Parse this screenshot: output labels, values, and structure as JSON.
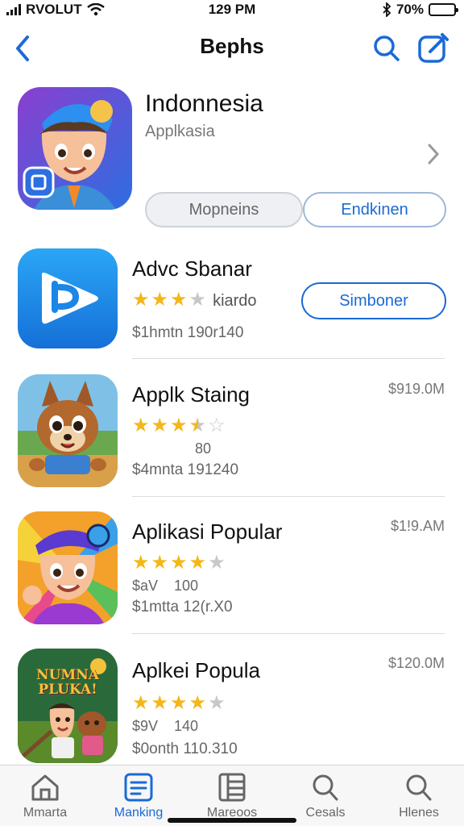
{
  "status_bar": {
    "carrier": "RVOLUT",
    "time": "129 PM",
    "battery": "70%",
    "battery_level": 0.7
  },
  "nav": {
    "title": "Bephs"
  },
  "featured": {
    "title": "Indonnesia",
    "subtitle": "Applkasia",
    "segments": [
      "Mopneins",
      "Endkinen"
    ]
  },
  "apps": [
    {
      "title": "Advc Sbanar",
      "rating": 3,
      "rating_text": "kiardo",
      "meta": "$1hmtn 190r140",
      "button": "Simboner",
      "icon": "play-icon"
    },
    {
      "title": "Applk Staing",
      "rating": 3.5,
      "price": "$919.0M",
      "extra": "80",
      "meta": "$4mnta 191240",
      "icon": "cartoon-fox-icon"
    },
    {
      "title": "Aplikasi Popular",
      "rating": 4,
      "price": "$1!9.AM",
      "extra": "$aV    100",
      "meta": "$1mtta 12(r.X0",
      "icon": "cartoon-kid-icon"
    },
    {
      "title": "Aplkei Popula",
      "rating": 4,
      "price": "$120.0M",
      "extra": "$9V    140",
      "meta": "$0onth 110.310",
      "icon": "cartoon-friends-icon",
      "icon_text": "NUMNA PLUKA!"
    }
  ],
  "tabs": [
    {
      "label": "Mmarta",
      "icon": "home-icon"
    },
    {
      "label": "Manking",
      "icon": "ranking-icon",
      "active": true
    },
    {
      "label": "Mareoos",
      "icon": "grid-icon"
    },
    {
      "label": "Cesals",
      "icon": "search-icon"
    },
    {
      "label": "Hlenes",
      "icon": "search-icon"
    }
  ],
  "colors": {
    "accent": "#1b6ad6",
    "star": "#f3b718"
  }
}
